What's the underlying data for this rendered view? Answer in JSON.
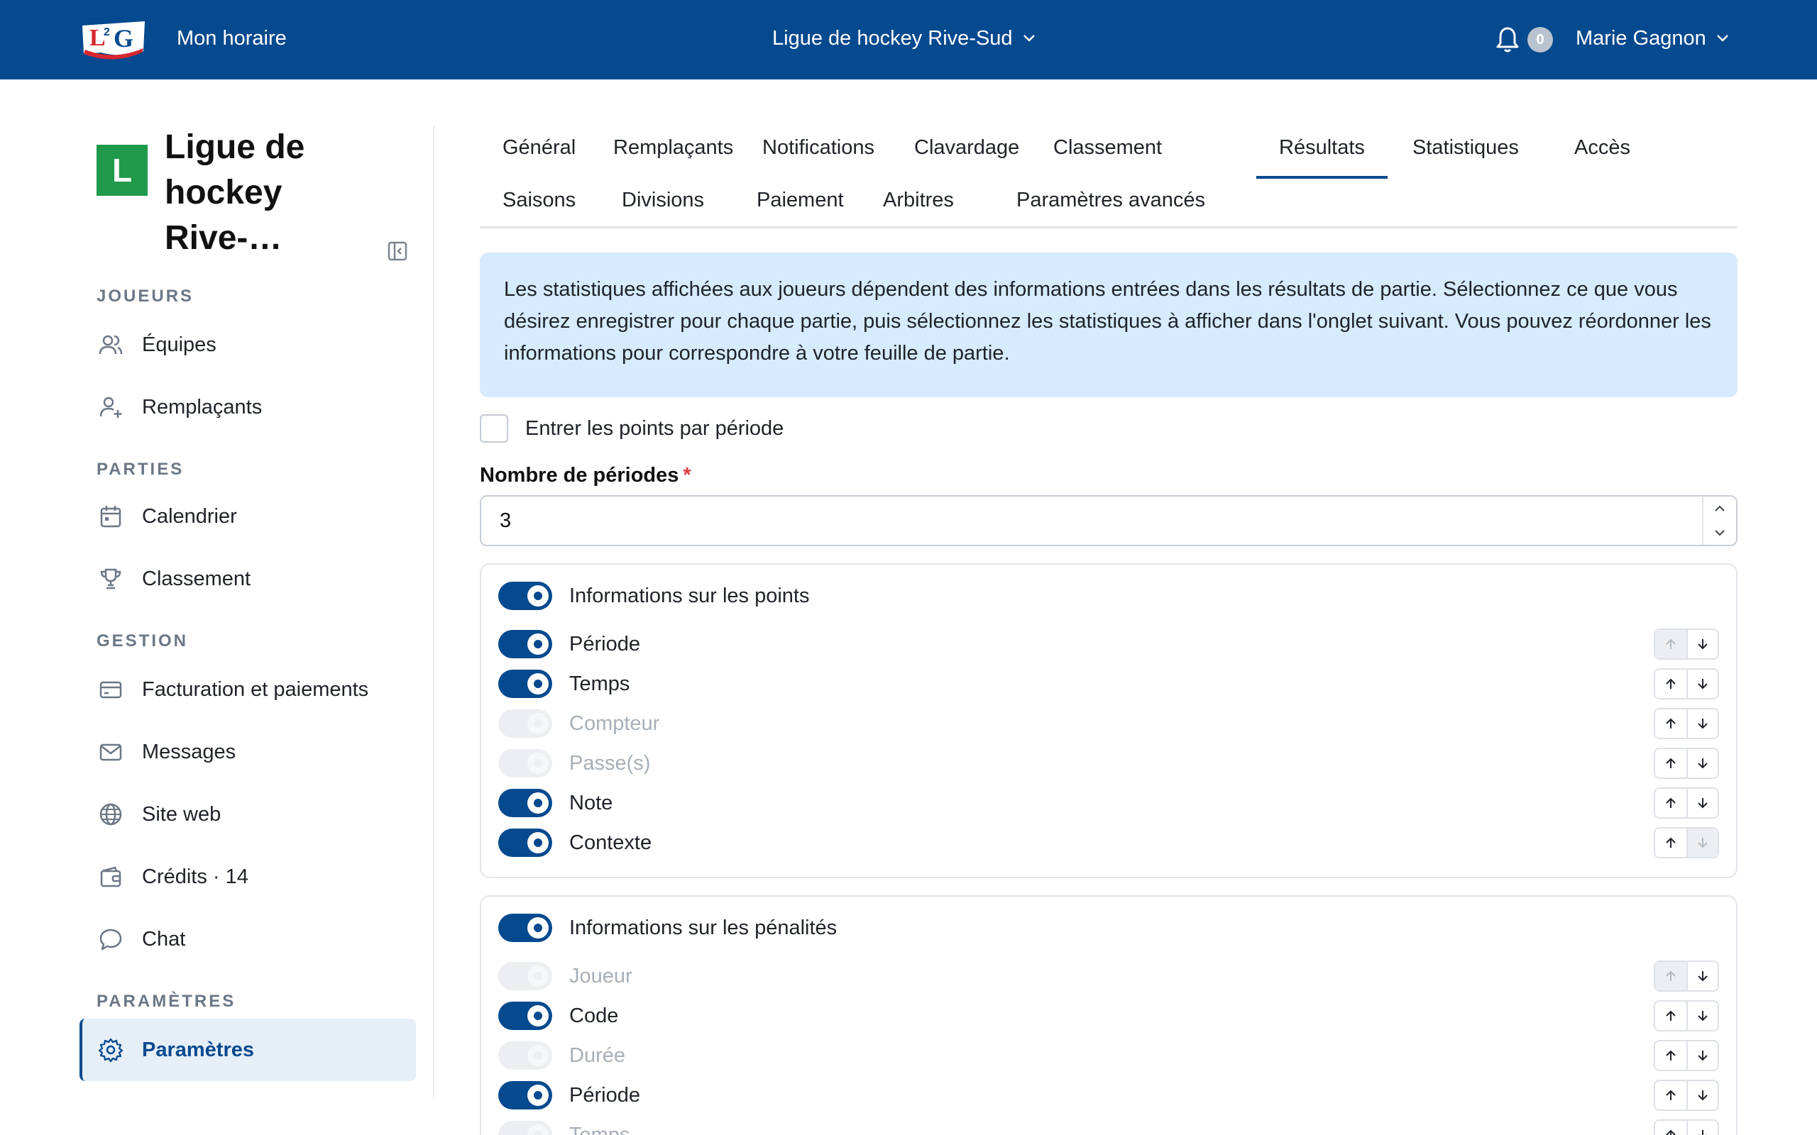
{
  "header": {
    "logo_text": "L2G",
    "my_schedule": "Mon horaire",
    "league_switch": "Ligue de hockey Rive-Sud",
    "notification_count": "0",
    "user_name": "Marie Gagnon"
  },
  "sidebar": {
    "league_initial": "L",
    "league_name": "Ligue de hockey Rive-…",
    "sections": [
      {
        "title": "JOUEURS",
        "items": [
          {
            "label": "Équipes",
            "icon": "users-icon"
          },
          {
            "label": "Remplaçants",
            "icon": "user-plus-icon"
          }
        ]
      },
      {
        "title": "PARTIES",
        "items": [
          {
            "label": "Calendrier",
            "icon": "calendar-icon"
          },
          {
            "label": "Classement",
            "icon": "trophy-icon"
          }
        ]
      },
      {
        "title": "GESTION",
        "items": [
          {
            "label": "Facturation et paiements",
            "icon": "credit-card-icon"
          },
          {
            "label": "Messages",
            "icon": "mail-icon"
          },
          {
            "label": "Site web",
            "icon": "globe-icon"
          },
          {
            "label": "Crédits · 14",
            "icon": "wallet-icon"
          },
          {
            "label": "Chat",
            "icon": "chat-icon"
          }
        ]
      },
      {
        "title": "PARAMÈTRES",
        "items": [
          {
            "label": "Paramètres",
            "icon": "gear-icon",
            "active": true
          }
        ]
      }
    ]
  },
  "tabs": {
    "row1": [
      "Général",
      "Remplaçants",
      "Notifications",
      "Clavardage",
      "Classement",
      "Résultats",
      "Statistiques",
      "Accès"
    ],
    "row2": [
      "Saisons",
      "Divisions",
      "Paiement",
      "Arbitres",
      "Paramètres avancés"
    ],
    "active": "Résultats"
  },
  "content": {
    "info": "Les statistiques affichées aux joueurs dépendent des informations entrées dans les résultats de partie. Sélectionnez ce que vous désirez enregistrer pour chaque partie, puis sélectionnez les statistiques à afficher dans l'onglet suivant. Vous pouvez réordonner les informations pour correspondre à votre feuille de partie.",
    "points_per_period_label": "Entrer les points par période",
    "points_per_period_checked": false,
    "periods_label": "Nombre de périodes",
    "periods_required_mark": "*",
    "periods_value": "3",
    "groups": [
      {
        "title": "Informations sur les points",
        "enabled": true,
        "rows": [
          {
            "label": "Période",
            "enabled": true,
            "up": false,
            "down": true
          },
          {
            "label": "Temps",
            "enabled": true,
            "up": true,
            "down": true
          },
          {
            "label": "Compteur",
            "enabled": false,
            "up": true,
            "down": true
          },
          {
            "label": "Passe(s)",
            "enabled": false,
            "up": true,
            "down": true
          },
          {
            "label": "Note",
            "enabled": true,
            "up": true,
            "down": true
          },
          {
            "label": "Contexte",
            "enabled": true,
            "up": true,
            "down": false
          }
        ]
      },
      {
        "title": "Informations sur les pénalités",
        "enabled": true,
        "rows": [
          {
            "label": "Joueur",
            "enabled": false,
            "up": false,
            "down": true
          },
          {
            "label": "Code",
            "enabled": true,
            "up": true,
            "down": true
          },
          {
            "label": "Durée",
            "enabled": false,
            "up": true,
            "down": true
          },
          {
            "label": "Période",
            "enabled": true,
            "up": true,
            "down": true
          },
          {
            "label": "Temps",
            "enabled": false,
            "up": true,
            "down": true
          }
        ]
      }
    ]
  },
  "colors": {
    "brand": "#05498f",
    "info_bg": "#d6ebfd",
    "league_avatar": "#1f9a4a"
  }
}
